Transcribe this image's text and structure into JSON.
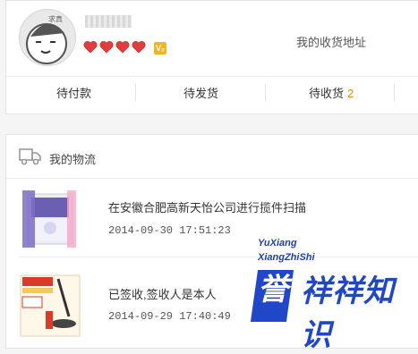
{
  "profile": {
    "avatar_label": "求真",
    "address_link": "我的收货地址",
    "vip_badge": "V₂",
    "hearts": 4
  },
  "order_tabs": [
    {
      "label": "待付款",
      "count": ""
    },
    {
      "label": "待发货",
      "count": ""
    },
    {
      "label": "待收货",
      "count": "2"
    }
  ],
  "logistics": {
    "title": "我的物流",
    "items": [
      {
        "status": "在安徽合肥高新天怡公司进行揽件扫描",
        "time": "2014-09-30 17:51:23"
      },
      {
        "status": "已签收,签收人是本人",
        "time": "2014-09-29 17:40:49"
      }
    ]
  },
  "watermark": {
    "line1": "YuXiang",
    "line2": "XiangZhiShi",
    "brand": "誉祥祥知识",
    "mark_char": "誉"
  },
  "colors": {
    "accent_count": "#e08a00",
    "heart_red": "#e23c3c",
    "watermark_blue": "#1f47c8"
  }
}
